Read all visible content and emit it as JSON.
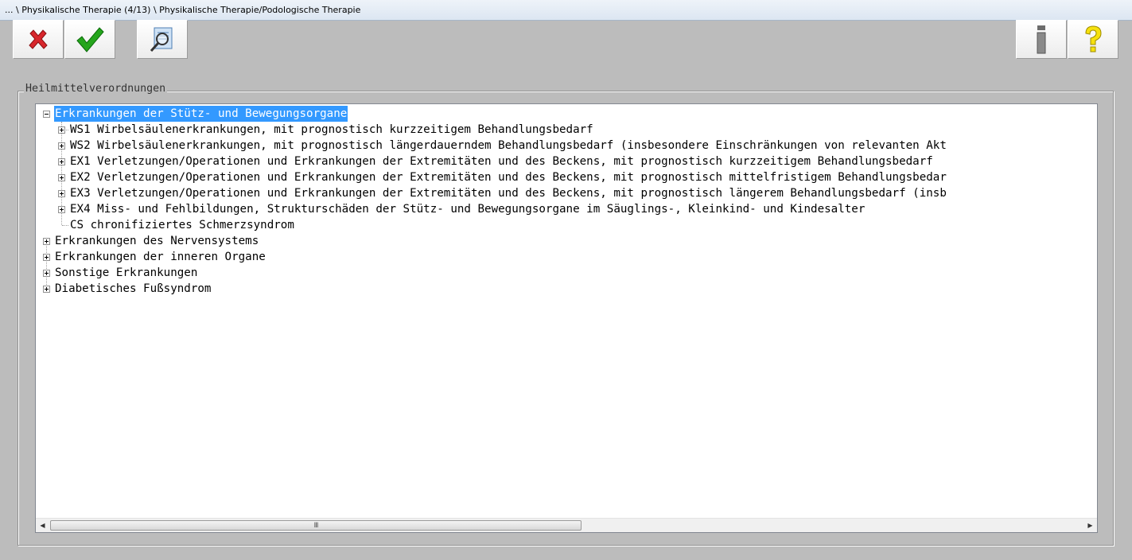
{
  "window": {
    "title": "... \\ Physikalische Therapie (4/13) \\ Physikalische Therapie/Podologische Therapie"
  },
  "toolbar": {
    "cancel_icon": "red-x-icon",
    "ok_icon": "green-check-icon",
    "search_icon": "magnifier-document-icon",
    "info_icon": "info-icon",
    "help_icon": "help-question-icon"
  },
  "group": {
    "legend": "Heilmittelverordnungen"
  },
  "tree": {
    "root1": {
      "label": "Erkrankungen der Stütz- und Bewegungsorgane",
      "expanded": true,
      "selected": true,
      "children": [
        "WS1 Wirbelsäulenerkrankungen, mit prognostisch kurzzeitigem Behandlungsbedarf",
        "WS2 Wirbelsäulenerkrankungen, mit prognostisch längerdauerndem Behandlungsbedarf (insbesondere Einschränkungen von relevanten Akt",
        "EX1 Verletzungen/Operationen und Erkrankungen der Extremitäten und des Beckens, mit prognostisch kurzzeitigem Behandlungsbedarf",
        "EX2 Verletzungen/Operationen und Erkrankungen der Extremitäten und des Beckens, mit prognostisch mittelfristigem Behandlungsbedar",
        "EX3 Verletzungen/Operationen und Erkrankungen der Extremitäten und des Beckens, mit prognostisch längerem Behandlungsbedarf (insb",
        "EX4 Miss- und Fehlbildungen, Strukturschäden der Stütz- und Bewegungsorgane im Säuglings-, Kleinkind- und Kindesalter",
        "CS chronifiziertes Schmerzsyndrom"
      ]
    },
    "root2": "Erkrankungen des Nervensystems",
    "root3": "Erkrankungen der inneren Organe",
    "root4": "Sonstige Erkrankungen",
    "root5": "Diabetisches Fußsyndrom"
  },
  "scrollbar": {
    "grip": "III",
    "left_arrow": "◀",
    "right_arrow": "▶"
  },
  "colors": {
    "selection": "#3399ff",
    "background": "#bcbcbc",
    "panel": "#ffffff"
  }
}
